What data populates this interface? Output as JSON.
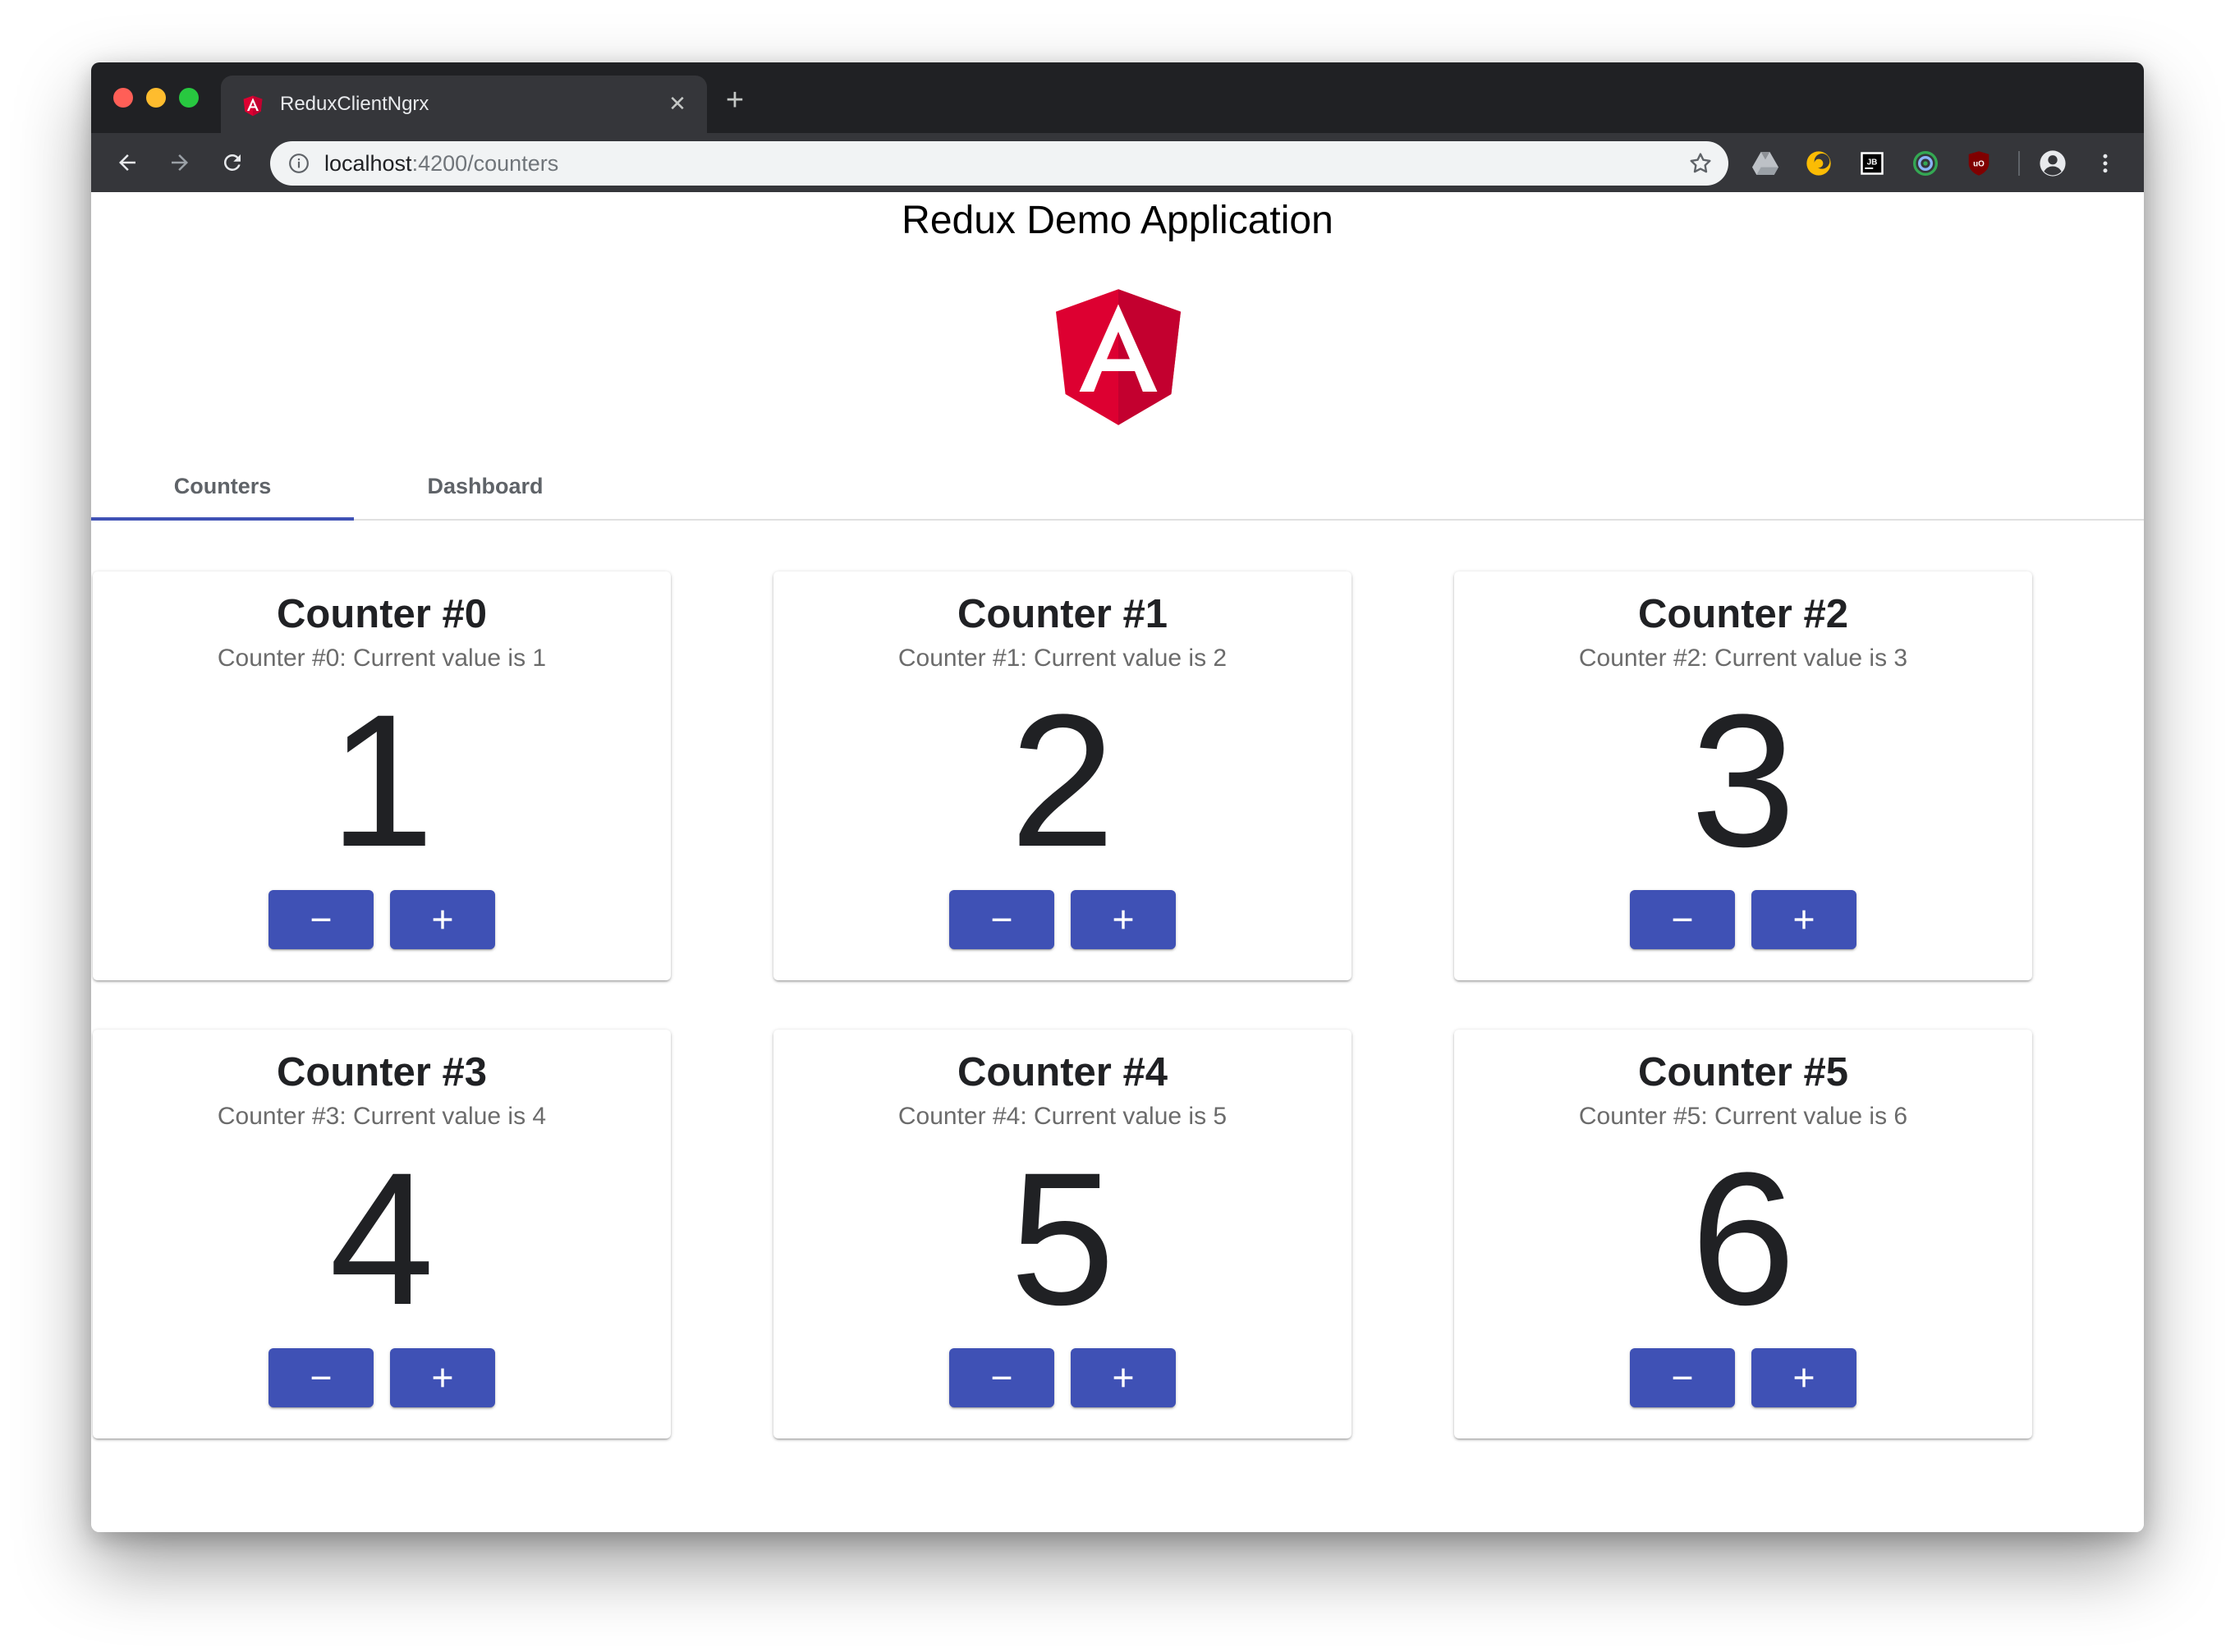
{
  "browser": {
    "tab_title": "ReduxClientNgrx",
    "url_host": "localhost",
    "url_path": ":4200/counters"
  },
  "app": {
    "title": "Redux Demo Application"
  },
  "nav": {
    "tabs": [
      {
        "label": "Counters",
        "active": true
      },
      {
        "label": "Dashboard",
        "active": false
      }
    ]
  },
  "counters": [
    {
      "title": "Counter #0",
      "subtitle": "Counter #0: Current value is 1",
      "value": "1",
      "dec_label": "−",
      "inc_label": "+"
    },
    {
      "title": "Counter #1",
      "subtitle": "Counter #1: Current value is 2",
      "value": "2",
      "dec_label": "−",
      "inc_label": "+"
    },
    {
      "title": "Counter #2",
      "subtitle": "Counter #2: Current value is 3",
      "value": "3",
      "dec_label": "−",
      "inc_label": "+"
    },
    {
      "title": "Counter #3",
      "subtitle": "Counter #3: Current value is 4",
      "value": "4",
      "dec_label": "−",
      "inc_label": "+"
    },
    {
      "title": "Counter #4",
      "subtitle": "Counter #4: Current value is 5",
      "value": "5",
      "dec_label": "−",
      "inc_label": "+"
    },
    {
      "title": "Counter #5",
      "subtitle": "Counter #5: Current value is 6",
      "value": "6",
      "dec_label": "−",
      "inc_label": "+"
    }
  ],
  "colors": {
    "primary": "#3f51b5",
    "angular_red": "#dd0031",
    "browser_frame": "#202124"
  },
  "icons": [
    "angular-icon",
    "close-icon",
    "plus-icon",
    "back-arrow-icon",
    "forward-arrow-icon",
    "reload-icon",
    "info-icon",
    "star-icon",
    "drive-icon",
    "moon-icon",
    "jetbrains-icon",
    "target-icon",
    "ublock-icon",
    "profile-icon",
    "more-vert-icon"
  ]
}
